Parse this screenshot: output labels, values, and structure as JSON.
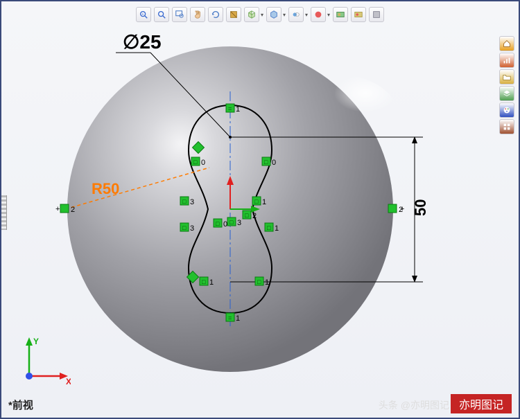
{
  "status": {
    "view": "*前视"
  },
  "watermark": {
    "text": "亦明图记",
    "attribution": "头条 @亦明图记"
  },
  "dimensions": {
    "diameter_label": "∅25",
    "height_label": "50",
    "radius_label": "R50"
  },
  "triad": {
    "x": "X",
    "y": "Y"
  },
  "markers": {
    "top_eq": "1",
    "tan_l0": "0",
    "tan_r0": "0",
    "mid_l3a": "3",
    "mid_l3b": "3",
    "mid_r1a": "1",
    "mid_r1b": "1",
    "ctr_0": "0",
    "ctr_3": "3",
    "ctr_2": "2",
    "btm_l1": "1",
    "btm_r1": "1",
    "btm_eq": "1",
    "ext_l2": "2",
    "ext_r2": "2"
  },
  "toolbar_top": [
    {
      "name": "zoom-fit-icon"
    },
    {
      "name": "zoom-area-icon"
    },
    {
      "name": "zoom-window-icon"
    },
    {
      "name": "pan-icon"
    },
    {
      "name": "rotate-icon"
    },
    {
      "name": "section-icon"
    },
    {
      "name": "view-cube-icon",
      "dd": true
    },
    {
      "name": "display-style-icon",
      "dd": true
    },
    {
      "name": "hide-show-icon",
      "dd": true
    },
    {
      "name": "appearance-icon",
      "dd": true
    },
    {
      "name": "scene-icon"
    },
    {
      "name": "render-icon"
    },
    {
      "name": "settings-icon"
    }
  ],
  "toolbar_right": [
    {
      "name": "home-icon",
      "color": "#e8a020"
    },
    {
      "name": "chart-icon",
      "color": "#d06030"
    },
    {
      "name": "folder-icon",
      "color": "#d8b040"
    },
    {
      "name": "layers-icon",
      "color": "#50a050"
    },
    {
      "name": "palette-icon",
      "color": "#3050c0"
    },
    {
      "name": "materials-icon",
      "color": "#a05030"
    }
  ]
}
